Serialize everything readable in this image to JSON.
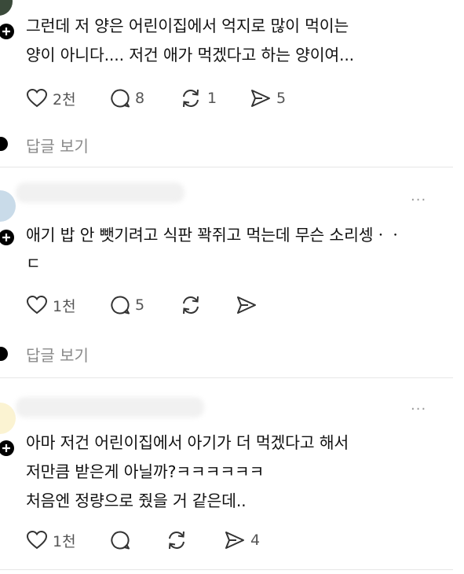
{
  "comments": [
    {
      "lines": [
        "그런데 저 양은 어린이집에서 억지로 많이 먹이는",
        "양이 아니다.... 저건 애가 먹겠다고 하는 양이여..."
      ],
      "likes": "2천",
      "replies": "8",
      "reposts": "1",
      "shares": "5",
      "reply_link": "답글 보기"
    },
    {
      "lines": [
        "애기 밥 안 뺏기려고 식판 꽉쥐고 먹는데 무슨 소리셍ㆍㆍ",
        "ㄷ"
      ],
      "likes": "1천",
      "replies": "5",
      "reposts": "",
      "shares": "",
      "reply_link": "답글 보기",
      "more": "···"
    },
    {
      "lines": [
        "아마 저건 어린이집에서 아기가 더 먹겠다고 해서",
        "저만큼 받은게 아닐까?ㅋㅋㅋㅋㅋㅋ",
        "처음엔 정량으로 줬을 거 같은데.."
      ],
      "likes": "1천",
      "replies": "",
      "reposts": "",
      "shares": "4",
      "more": "···"
    }
  ],
  "colors": {
    "text": "#111111",
    "muted": "#8a8a8a",
    "icon": "#333333",
    "divider": "#e6e6e6"
  },
  "icons": [
    "heart-icon",
    "comment-icon",
    "repost-icon",
    "share-icon",
    "add-icon",
    "more-icon"
  ]
}
